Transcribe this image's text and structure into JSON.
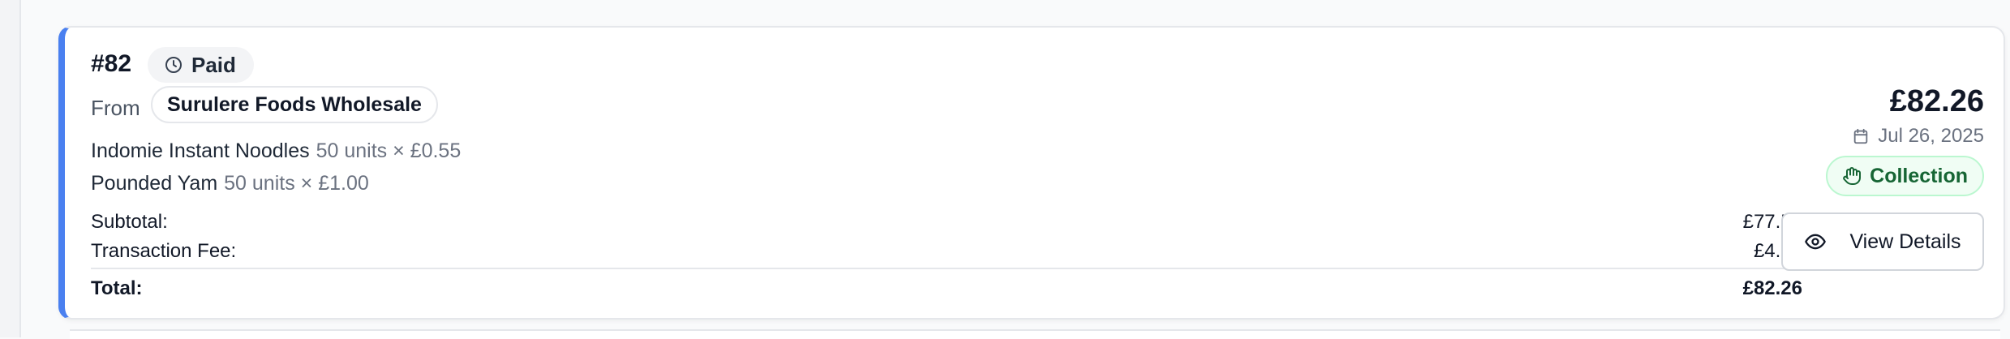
{
  "order": {
    "id": "#82",
    "status": "Paid",
    "status_icon": "clock-icon",
    "from_label": "From",
    "supplier": "Surulere Foods Wholesale",
    "items": [
      {
        "name": "Indomie Instant Noodles",
        "detail": "50 units × £0.55"
      },
      {
        "name": "Pounded Yam",
        "detail": "50 units × £1.00"
      }
    ],
    "totals": {
      "subtotal_label": "Subtotal:",
      "subtotal_value": "£77.50",
      "fee_label": "Transaction Fee:",
      "fee_value": "£4.76",
      "total_label": "Total:",
      "total_value": "£82.26"
    },
    "price": "£82.26",
    "date": "Jul 26, 2025",
    "date_icon": "calendar-icon",
    "fulfillment": "Collection",
    "fulfillment_icon": "hand-icon",
    "view_button_label": "View Details",
    "view_button_icon": "eye-icon"
  },
  "colors": {
    "accent": "#4a80f0",
    "collection_text": "#166534",
    "collection_bg": "#f0fdf4",
    "collection_border": "#bbf7d0"
  }
}
